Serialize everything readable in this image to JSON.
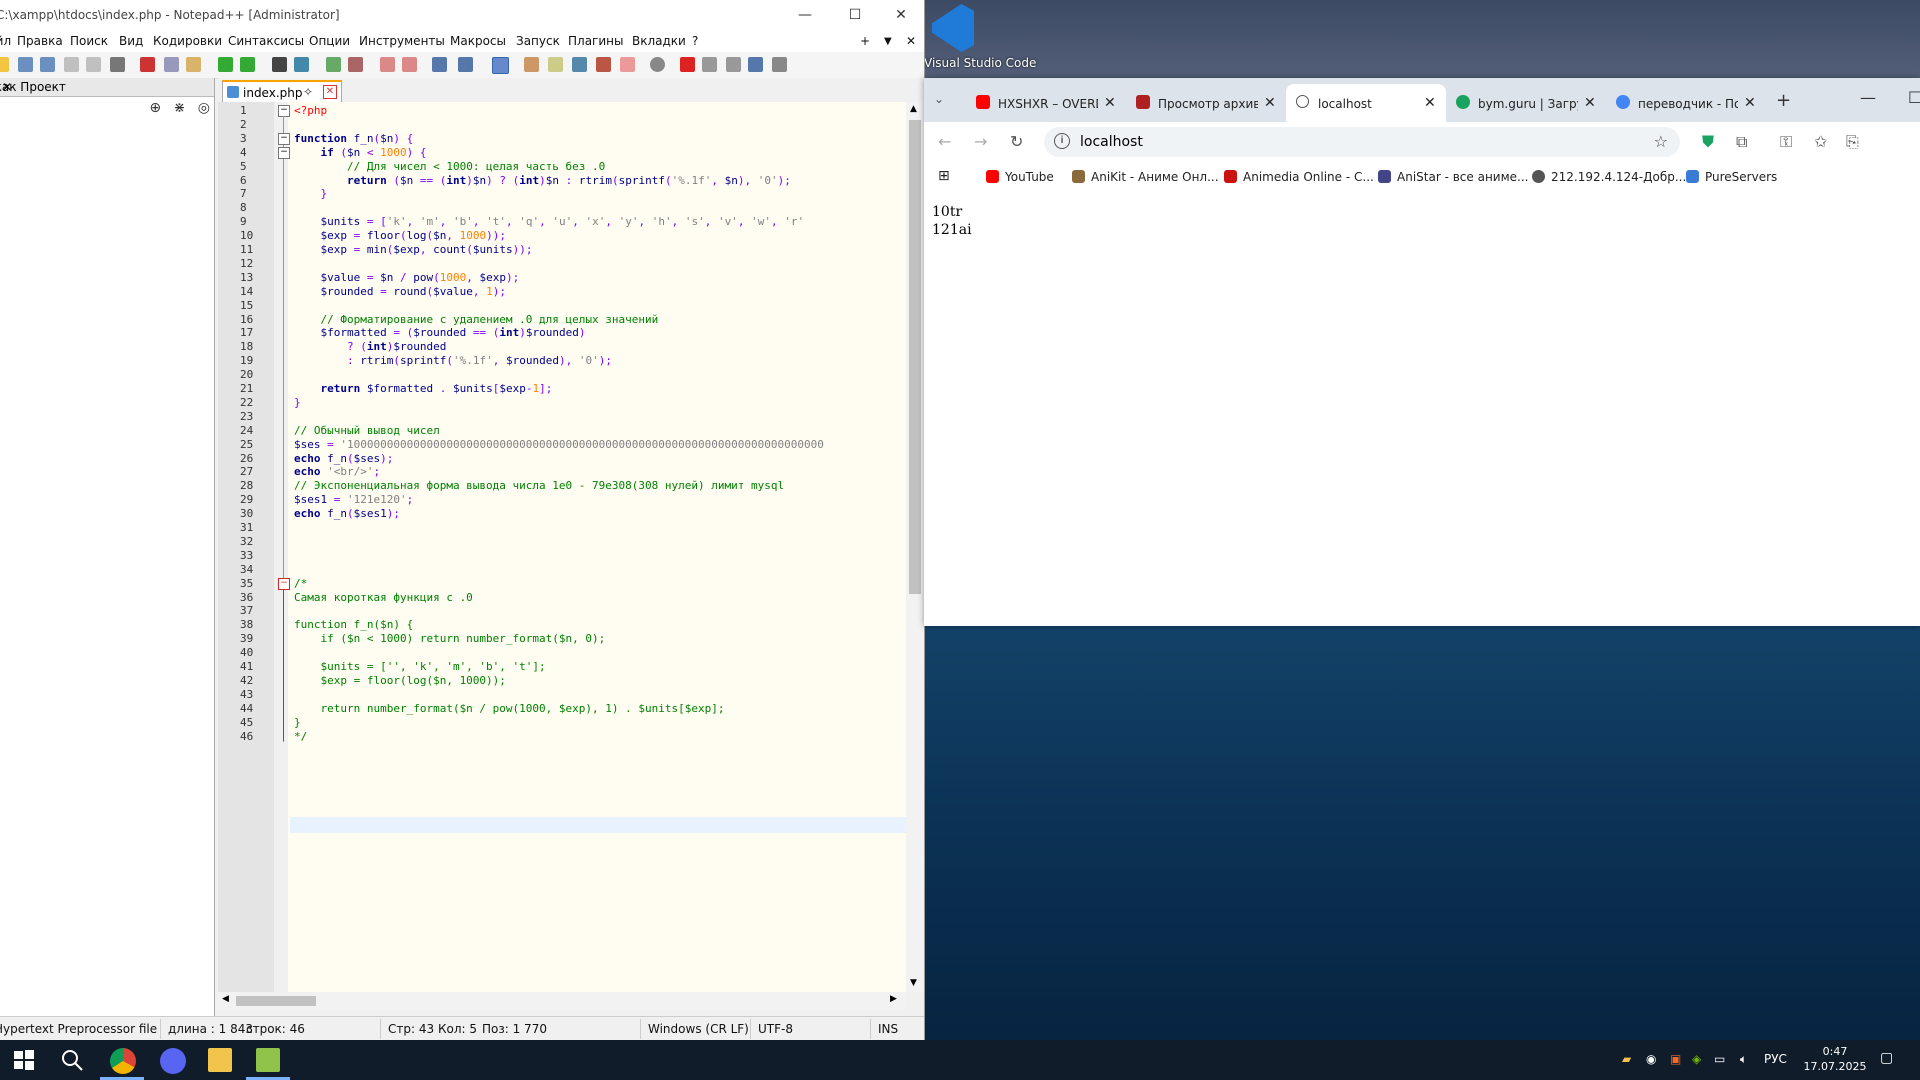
{
  "npp": {
    "title": "C:\\xampp\\htdocs\\index.php - Notepad++ [Administrator]",
    "menu": [
      "Файл",
      "Правка",
      "Поиск",
      "Вид",
      "Кодировки",
      "Синтаксисы",
      "Опции",
      "Инструменты",
      "Макросы",
      "Запуск",
      "Плагины",
      "Вкладки",
      "?"
    ],
    "menu_right": [
      "+",
      "▼",
      "✕"
    ],
    "panel_title": "Папка как Проект",
    "tab_name": "index.php",
    "status": {
      "filetype": "Hypertext Preprocessor file",
      "length": "длина : 1 843",
      "lines": "строк: 46",
      "line": "Стр: 43",
      "col": "Кол: 5",
      "pos": "Поз: 1 770",
      "eol": "Windows (CR LF)",
      "encoding": "UTF-8",
      "mode": "INS"
    },
    "code": [
      "<?php",
      "",
      "function f_n($n) {",
      "    if ($n < 1000) {",
      "        // Для чисел < 1000: целая часть без .0",
      "        return ($n == (int)$n) ? (int)$n : rtrim(sprintf('%.1f', $n), '0');",
      "    }",
      "",
      "    $units = ['k', 'm', 'b', 't', 'q', 'u', 'x', 'y', 'h', 's', 'v', 'w', 'r'",
      "    $exp = floor(log($n, 1000));",
      "    $exp = min($exp, count($units));",
      "",
      "    $value = $n / pow(1000, $exp);",
      "    $rounded = round($value, 1);",
      "",
      "    // Форматирование с удалением .0 для целых значений",
      "    $formatted = ($rounded == (int)$rounded)",
      "        ? (int)$rounded",
      "        : rtrim(sprintf('%.1f', $rounded), '0');",
      "",
      "    return $formatted . $units[$exp-1];",
      "}",
      "",
      "// Обычный вывод чисел",
      "$ses = '100000000000000000000000000000000000000000000000000000000000000000000000",
      "echo f_n($ses);",
      "echo '<br/>';",
      "// Экспоненциальная форма вывода числа 1e0 - 79e308(308 нулей) лимит mysql",
      "$ses1 = '121e120';",
      "echo f_n($ses1);",
      "",
      "",
      "",
      "",
      "/*",
      "Самая короткая функция с .0",
      "",
      "function f_n($n) {",
      "    if ($n < 1000) return number_format($n, 0);",
      "",
      "    $units = ['', 'k', 'm', 'b', 't'];",
      "    $exp = floor(log($n, 1000));",
      "",
      "    return number_format($n / pow(1000, $exp), 1) . $units[$exp];",
      "}",
      "*/"
    ]
  },
  "desktop_icon": {
    "label": "Visual Studio Code"
  },
  "chrome": {
    "tabs": [
      {
        "title": "HXSHXR – OVERDOSE",
        "color": "#ff0000"
      },
      {
        "title": "Просмотр архива",
        "color": "#b02020"
      },
      {
        "title": "localhost",
        "color": "#555555"
      },
      {
        "title": "bym.guru | Загрузки",
        "color": "#1aa260"
      },
      {
        "title": "переводчик - Поиск",
        "color": "#4285f4"
      }
    ],
    "new_tab": "+",
    "address": "localhost",
    "bookmarks": [
      {
        "label": "YouTube",
        "color": "#ff0000"
      },
      {
        "label": "AniKit - Аниме Онл...",
        "color": "#8a6a3a"
      },
      {
        "label": "Animedia Online - C...",
        "color": "#cc1111"
      },
      {
        "label": "AniStar - все аниме...",
        "color": "#444488"
      },
      {
        "label": "212.192.4.124-Добр...",
        "color": "#555555"
      },
      {
        "label": "PureServers",
        "color": "#3a7bd5"
      }
    ],
    "page_lines": [
      "10tr",
      "121ai"
    ]
  },
  "taskbar": {
    "lang": "РУС",
    "time": "0:47",
    "date": "17.07.2025"
  }
}
